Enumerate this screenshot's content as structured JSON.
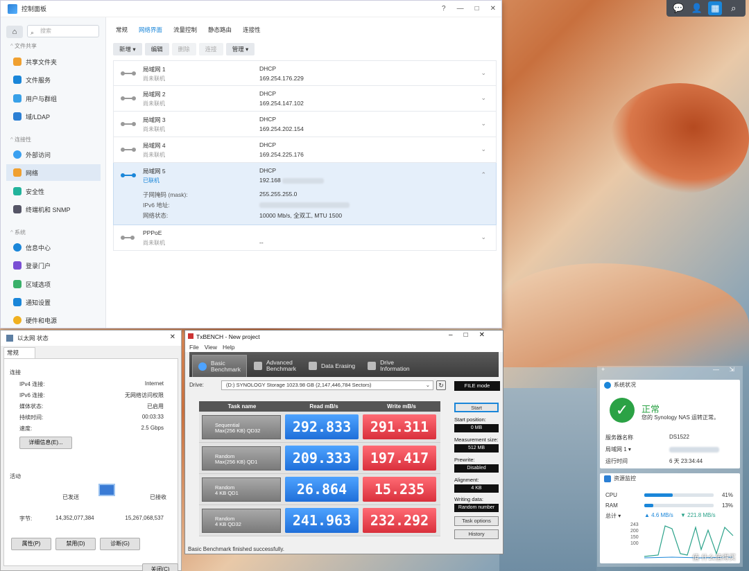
{
  "control_panel": {
    "title": "控制面板",
    "win_buttons": [
      "?",
      "—",
      "□",
      "✕"
    ],
    "search_placeholder": "搜索",
    "sections": {
      "file_sharing": "文件共享",
      "connectivity": "连接性",
      "system": "系统"
    },
    "nav": [
      "共享文件夹",
      "文件服务",
      "用户与群组",
      "域/LDAP",
      "外部访问",
      "网络",
      "安全性",
      "终端机和 SNMP",
      "信息中心",
      "登录门户",
      "区域选项",
      "通知设置",
      "硬件和电源"
    ],
    "tabs": [
      "常规",
      "网络界面",
      "流量控制",
      "静态路由",
      "连接性"
    ],
    "toolbar": [
      "新增 ▾",
      "编辑",
      "删除",
      "连接",
      "管理 ▾"
    ],
    "interfaces": [
      {
        "name": "局域网 1",
        "status": "尚未联机",
        "type": "DHCP",
        "ip": "169.254.176.229"
      },
      {
        "name": "局域网 2",
        "status": "尚未联机",
        "type": "DHCP",
        "ip": "169.254.147.102"
      },
      {
        "name": "局域网 3",
        "status": "尚未联机",
        "type": "DHCP",
        "ip": "169.254.202.154"
      },
      {
        "name": "局域网 4",
        "status": "尚未联机",
        "type": "DHCP",
        "ip": "169.254.225.176"
      },
      {
        "name": "局域网 5",
        "status": "已联机",
        "type": "DHCP",
        "ip": "192.168"
      },
      {
        "name": "PPPoE",
        "status": "尚未联机",
        "type": "",
        "ip": "--"
      }
    ],
    "lan5_details": {
      "mask_label": "子网掩码 (mask):",
      "mask_value": "255.255.255.0",
      "ipv6_label": "IPv6 地址:",
      "state_label": "网络状态:",
      "state_value": "10000 Mb/s, 全双工, MTU 1500"
    }
  },
  "ethernet_status": {
    "title": "以太网 状态",
    "tab": "常规",
    "connection_header": "连接",
    "rows": [
      {
        "label": "IPv4 连接:",
        "value": "Internet"
      },
      {
        "label": "IPv6 连接:",
        "value": "无网络访问权限"
      },
      {
        "label": "媒体状态:",
        "value": "已启用"
      },
      {
        "label": "持续时间:",
        "value": "00:03:33"
      },
      {
        "label": "速度:",
        "value": "2.5 Gbps"
      }
    ],
    "details_button": "详细信息(E)...",
    "activity_header": "活动",
    "sent_label": "已发送",
    "received_label": "已接收",
    "bytes_label": "字节:",
    "bytes_sent": "14,352,077,384",
    "bytes_received": "15,267,068,537",
    "buttons": [
      "属性(P)",
      "禁用(D)",
      "诊断(G)"
    ],
    "close_button": "关闭(C)"
  },
  "txbench": {
    "title": "TxBENCH - New project",
    "menu": [
      "File",
      "View",
      "Help"
    ],
    "tabs": [
      {
        "l1": "Basic",
        "l2": "Benchmark"
      },
      {
        "l1": "Advanced",
        "l2": "Benchmark"
      },
      {
        "l1": "Data Erasing",
        "l2": ""
      },
      {
        "l1": "Drive",
        "l2": "Information"
      }
    ],
    "drive_label": "Drive:",
    "drive_value": "(D:) SYNOLOGY Storage  1023.98 GB (2,147,446,784 Sectors)",
    "file_mode": "FILE mode",
    "headers": [
      "Task name",
      "Read mB/s",
      "Write mB/s"
    ],
    "rows": [
      {
        "l1": "Sequential",
        "l2": "Max(256 KB) QD32",
        "read": "292.833",
        "write": "291.311"
      },
      {
        "l1": "Random",
        "l2": "Max(256 KB) QD1",
        "read": "209.333",
        "write": "197.417"
      },
      {
        "l1": "Random",
        "l2": "4 KB QD1",
        "read": "26.864",
        "write": "15.235"
      },
      {
        "l1": "Random",
        "l2": "4 KB QD32",
        "read": "241.963",
        "write": "232.292"
      }
    ],
    "start": "Start",
    "settings": [
      {
        "label": "Start position:",
        "value": "0 MB"
      },
      {
        "label": "Measurement size:",
        "value": "512 MB"
      },
      {
        "label": "Prewrite:",
        "value": "Disabled"
      },
      {
        "label": "Alignment:",
        "value": "4 KB"
      },
      {
        "label": "Writing data:",
        "value": "Random number"
      }
    ],
    "task_options": "Task options",
    "history": "History",
    "status": "Basic Benchmark finished successfully."
  },
  "widgets": {
    "system_status": {
      "title": "系统状况",
      "state": "正常",
      "message": "您的 Synology NAS 运转正常。",
      "server_label": "服务器名称",
      "server_value": "DS1522",
      "lan_label": "局域网 1 ▾",
      "uptime_label": "运行时间",
      "uptime_value": "6 天 23:34:44"
    },
    "resource_monitor": {
      "title": "资源监控",
      "cpu_label": "CPU",
      "cpu_value": "41%",
      "cpu": 0.41,
      "ram_label": "RAM",
      "ram_value": "13%",
      "ram": 0.13,
      "total_label": "总计 ▾",
      "up": "▲ 4.6 MB/s",
      "down": "▼ 221.8 MB/s",
      "axis": [
        "243",
        "200",
        "150",
        "100"
      ]
    }
  },
  "watermark": "值 什么值得买"
}
